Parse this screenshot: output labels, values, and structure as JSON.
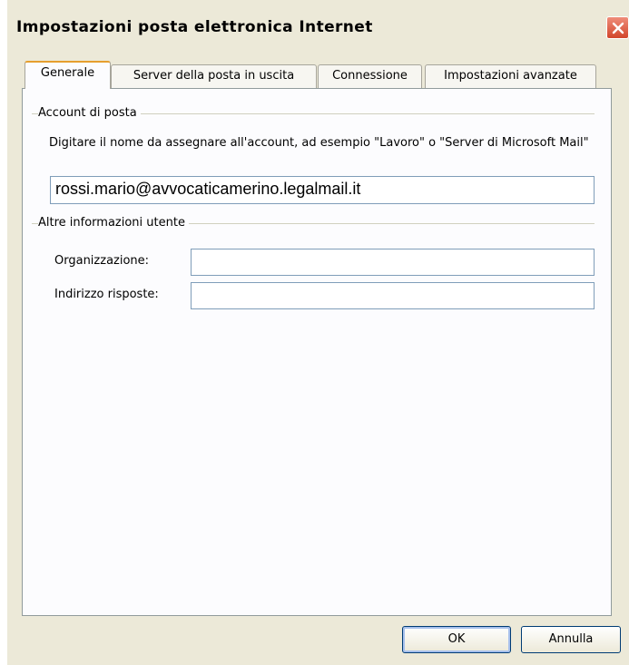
{
  "window": {
    "title": "Impostazioni posta elettronica Internet",
    "close_icon": "close-icon"
  },
  "tabs": [
    {
      "label": "Generale",
      "active": true
    },
    {
      "label": "Server della posta in uscita",
      "active": false
    },
    {
      "label": "Connessione",
      "active": false
    },
    {
      "label": "Impostazioni avanzate",
      "active": false
    }
  ],
  "account_group": {
    "title": "Account di posta",
    "description": "Digitare il nome da assegnare all'account, ad esempio \"Lavoro\" o \"Server di Microsoft Mail\"",
    "account_name_value": "rossi.mario@avvocaticamerino.legalmail.it"
  },
  "user_info_group": {
    "title": "Altre informazioni utente",
    "organization_label": "Organizzazione:",
    "organization_value": "",
    "reply_address_label": "Indirizzo risposte:",
    "reply_address_value": ""
  },
  "buttons": {
    "ok_label": "OK",
    "cancel_label": "Annulla"
  },
  "colors": {
    "dialog_background": "#ece9d8",
    "active_tab_accent": "#e69f2e",
    "close_button": "#d2452b",
    "field_border": "#7f9db9"
  }
}
